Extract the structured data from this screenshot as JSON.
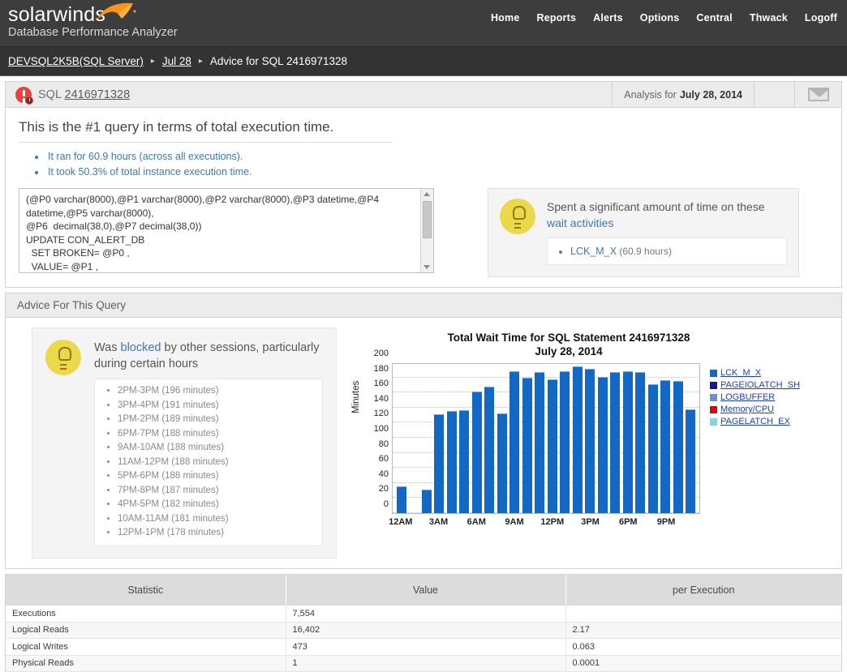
{
  "header": {
    "brand": "solarwinds",
    "product": "Database Performance Analyzer",
    "nav": [
      {
        "label": "Home"
      },
      {
        "label": "Reports"
      },
      {
        "label": "Alerts"
      },
      {
        "label": "Options"
      },
      {
        "label": "Central"
      },
      {
        "label": "Thwack"
      },
      {
        "label": "Logoff"
      }
    ]
  },
  "breadcrumb": {
    "instance": "DEVSQL2K5B(SQL Server)",
    "date": "Jul 28",
    "current": "Advice for SQL 2416971328",
    "separator": "▸"
  },
  "summary": {
    "panel_label": "SQL",
    "sql_id": "2416971328",
    "analysis_prefix": "Analysis for",
    "analysis_date": "July 28, 2014",
    "mail_icon": "envelope-icon",
    "title": "This is the #1 query in terms of total execution time.",
    "bullets": [
      "It ran for 60.9 hours (across all executions).",
      "It took 50.3% of total instance execution time."
    ],
    "sql_text": "(@P0 varchar(8000),@P1 varchar(8000),@P2 varchar(8000),@P3 datetime,@P4\ndatetime,@P5 varchar(8000),\n@P6  decimal(38,0),@P7 decimal(38,0))\nUPDATE CON_ALERT_DB\n  SET BROKEN= @P0 ,\n  VALUE= @P1 ,",
    "wait_card": {
      "icon": "lightbulb-icon",
      "title_lead": "Spent a significant amount of time on these",
      "title_link": "wait activities",
      "items": [
        {
          "name": "LCK_M_X",
          "detail": "(60.9 hours)"
        }
      ]
    }
  },
  "advice": {
    "header": "Advice For This Query",
    "card": {
      "icon": "lightbulb-icon",
      "title_pre": "Was ",
      "title_link": "blocked",
      "title_post": " by other sessions, particularly during certain hours",
      "items": [
        "2PM-3PM (196 minutes)",
        "3PM-4PM (191 minutes)",
        "1PM-2PM (189 minutes)",
        "6PM-7PM (188 minutes)",
        "9AM-10AM (188 minutes)",
        "11AM-12PM (188 minutes)",
        "5PM-6PM (188 minutes)",
        "7PM-8PM (187 minutes)",
        "4PM-5PM (182 minutes)",
        "10AM-11AM (181 minutes)",
        "12PM-1PM (178 minutes)"
      ]
    }
  },
  "chart_data": {
    "type": "bar",
    "title": "Total Wait Time for SQL Statement 2416971328",
    "subtitle": "July 28, 2014",
    "xlabel": "",
    "ylabel": "Minutes",
    "ylim": [
      0,
      200
    ],
    "yticks": [
      0,
      20,
      40,
      60,
      80,
      100,
      120,
      140,
      160,
      180,
      200
    ],
    "grid": true,
    "legend_position": "right",
    "categories": [
      "12AM",
      "1AM",
      "2AM",
      "3AM",
      "4AM",
      "5AM",
      "6AM",
      "7AM",
      "8AM",
      "9AM",
      "10AM",
      "11AM",
      "12PM",
      "1PM",
      "2PM",
      "3PM",
      "4PM",
      "5PM",
      "6PM",
      "7PM",
      "8PM",
      "9PM",
      "10PM",
      "11PM"
    ],
    "xtick_labels": [
      "12AM",
      "3AM",
      "6AM",
      "9AM",
      "12PM",
      "3PM",
      "6PM",
      "9PM"
    ],
    "xtick_categories": [
      "12AM",
      "3AM",
      "6AM",
      "9AM",
      "12PM",
      "3PM",
      "6PM",
      "9PM"
    ],
    "series": [
      {
        "name": "LCK_M_X",
        "color": "#1368c4",
        "values": [
          35,
          0,
          31,
          131,
          136,
          137,
          161,
          168,
          132,
          188,
          180,
          187,
          177,
          188,
          195,
          191,
          181,
          187,
          188,
          187,
          171,
          176,
          175,
          138
        ]
      }
    ],
    "legend": [
      {
        "label": "LCK_M_X",
        "color": "#1368c4"
      },
      {
        "label": "PAGEIOLATCH_SH",
        "color": "#14199e"
      },
      {
        "label": "LOGBUFFER",
        "color": "#6f93c4"
      },
      {
        "label": "Memory/CPU",
        "color": "#d60a0a"
      },
      {
        "label": "PAGELATCH_EX",
        "color": "#7fd9da"
      }
    ]
  },
  "stats_table": {
    "columns": [
      "Statistic",
      "Value",
      "per Execution"
    ],
    "rows": [
      [
        "Executions",
        "7,554",
        ""
      ],
      [
        "Logical Reads",
        "16,402",
        "2.17"
      ],
      [
        "Logical Writes",
        "473",
        "0.063"
      ],
      [
        "Physical Reads",
        "1",
        "0.0001"
      ]
    ]
  }
}
